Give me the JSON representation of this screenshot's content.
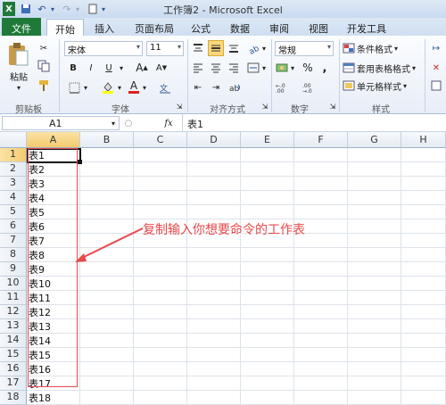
{
  "titlebar": {
    "title": "工作簿2 - Microsoft Excel"
  },
  "tabs": [
    "文件",
    "开始",
    "插入",
    "页面布局",
    "公式",
    "数据",
    "审阅",
    "视图",
    "开发工具"
  ],
  "ribbon": {
    "paste": "粘贴",
    "font_name": "宋体",
    "font_size": "11",
    "bold": "B",
    "italic": "I",
    "underline": "U",
    "grow_font": "A",
    "shrink_font": "A",
    "font_color_letter": "A",
    "number_format": "常规",
    "percent": "%",
    "comma": ",",
    "cond_format": "条件格式",
    "table_format": "套用表格格式",
    "cell_styles": "单元格样式",
    "groups": [
      "剪贴板",
      "字体",
      "对齐方式",
      "数字",
      "样式"
    ]
  },
  "formula_bar": {
    "name_box": "A1",
    "fx": "fx",
    "formula": "表1"
  },
  "columns": [
    "A",
    "B",
    "C",
    "D",
    "E",
    "F",
    "G",
    "H"
  ],
  "rows": [
    "1",
    "2",
    "3",
    "4",
    "5",
    "6",
    "7",
    "8",
    "9",
    "10",
    "11",
    "12",
    "13",
    "14",
    "15",
    "16",
    "17",
    "18"
  ],
  "cells": [
    "表1",
    "表2",
    "表3",
    "表4",
    "表5",
    "表6",
    "表7",
    "表8",
    "表9",
    "表10",
    "表11",
    "表12",
    "表13",
    "表14",
    "表15",
    "表16",
    "表17",
    "表18"
  ],
  "annotation": "复制输入你想要命令的工作表",
  "colors": {
    "annotation": "#e8494a",
    "file_tab": "#1f7a3a"
  }
}
